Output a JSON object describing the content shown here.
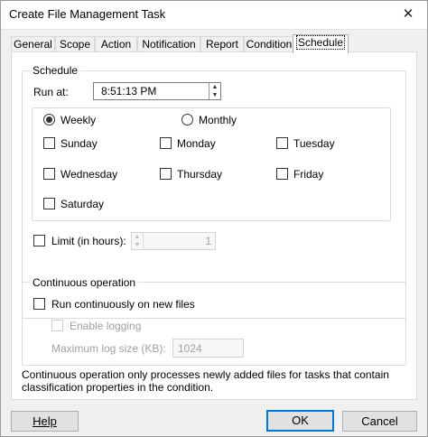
{
  "window": {
    "title": "Create File Management Task",
    "close_glyph": "✕"
  },
  "tabs": [
    {
      "label": "General"
    },
    {
      "label": "Scope"
    },
    {
      "label": "Action"
    },
    {
      "label": "Notification"
    },
    {
      "label": "Report"
    },
    {
      "label": "Condition"
    },
    {
      "label": "Schedule",
      "active": true
    }
  ],
  "schedule": {
    "legend": "Schedule",
    "run_at_label": "Run at:",
    "run_at_value": "8:51:13 PM",
    "frequency": [
      {
        "label": "Weekly",
        "selected": true
      },
      {
        "label": "Monthly",
        "selected": false
      }
    ],
    "days": [
      {
        "label": "Sunday",
        "checked": false
      },
      {
        "label": "Monday",
        "checked": false
      },
      {
        "label": "Tuesday",
        "checked": false
      },
      {
        "label": "Wednesday",
        "checked": false
      },
      {
        "label": "Thursday",
        "checked": false
      },
      {
        "label": "Friday",
        "checked": false
      },
      {
        "label": "Saturday",
        "checked": false
      }
    ],
    "limit_label": "Limit (in hours):",
    "limit_checked": false,
    "limit_value": "1"
  },
  "continuous": {
    "legend": "Continuous operation",
    "run_continuously_label": "Run continuously on new files",
    "run_continuously_checked": false,
    "enable_logging_label": "Enable logging",
    "max_log_label": "Maximum log size (KB):",
    "max_log_value": "1024"
  },
  "info_text": "Continuous operation only processes newly added files for tasks that contain classification properties in the condition.",
  "buttons": {
    "help": "Help",
    "ok": "OK",
    "cancel": "Cancel"
  },
  "icons": {
    "spin_up": "▲",
    "spin_down": "▼"
  }
}
